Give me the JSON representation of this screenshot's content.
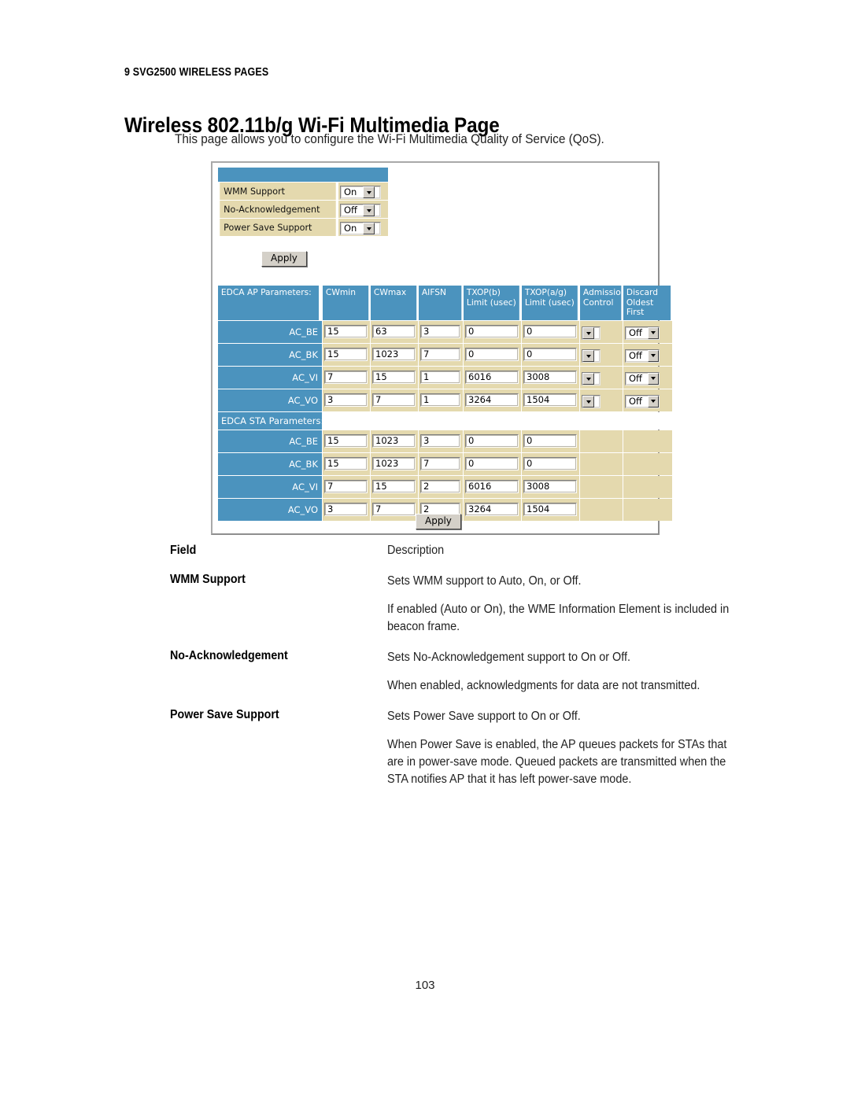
{
  "document": {
    "running_head": "9 SVG2500 WIRELESS PAGES",
    "title": "Wireless 802.11b/g Wi-Fi Multimedia Page",
    "intro": "This page allows you to configure the Wi-Fi Multimedia Quality of Service (QoS).",
    "page_number": "103"
  },
  "colors": {
    "header_blue": "#4b93be",
    "cell_beige": "#e4d9ae",
    "button_face": "#d4d0c8"
  },
  "screenshot": {
    "config": {
      "rows": [
        {
          "label": "WMM Support",
          "value": "On"
        },
        {
          "label": "No-Acknowledgement",
          "value": "Off"
        },
        {
          "label": "Power Save Support",
          "value": "On"
        }
      ],
      "apply_label": "Apply"
    },
    "edca": {
      "headers": {
        "ap_title": "EDCA AP Parameters:",
        "cwmin": "CWmin",
        "cwmax": "CWmax",
        "aifsn": "AIFSN",
        "txop_b_l1": "TXOP(b)",
        "txop_b_l2": "Limit (usec)",
        "txop_ag_l1": "TXOP(a/g)",
        "txop_ag_l2": "Limit (usec)",
        "admission_l1": "Admission",
        "admission_l2": "Control",
        "discard_l1": "Discard",
        "discard_l2": "Oldest First"
      },
      "sta_title": "EDCA STA Parameters:",
      "ap_rows": [
        {
          "ac": "AC_BE",
          "cwmin": "15",
          "cwmax": "63",
          "aifsn": "3",
          "txop_b": "0",
          "txop_ag": "0",
          "admission": "",
          "discard": "Off"
        },
        {
          "ac": "AC_BK",
          "cwmin": "15",
          "cwmax": "1023",
          "aifsn": "7",
          "txop_b": "0",
          "txop_ag": "0",
          "admission": "",
          "discard": "Off"
        },
        {
          "ac": "AC_VI",
          "cwmin": "7",
          "cwmax": "15",
          "aifsn": "1",
          "txop_b": "6016",
          "txop_ag": "3008",
          "admission": "",
          "discard": "Off"
        },
        {
          "ac": "AC_VO",
          "cwmin": "3",
          "cwmax": "7",
          "aifsn": "1",
          "txop_b": "3264",
          "txop_ag": "1504",
          "admission": "",
          "discard": "Off"
        }
      ],
      "sta_rows": [
        {
          "ac": "AC_BE",
          "cwmin": "15",
          "cwmax": "1023",
          "aifsn": "3",
          "txop_b": "0",
          "txop_ag": "0"
        },
        {
          "ac": "AC_BK",
          "cwmin": "15",
          "cwmax": "1023",
          "aifsn": "7",
          "txop_b": "0",
          "txop_ag": "0"
        },
        {
          "ac": "AC_VI",
          "cwmin": "7",
          "cwmax": "15",
          "aifsn": "2",
          "txop_b": "6016",
          "txop_ag": "3008"
        },
        {
          "ac": "AC_VO",
          "cwmin": "3",
          "cwmax": "7",
          "aifsn": "2",
          "txop_b": "3264",
          "txop_ag": "1504"
        }
      ],
      "apply_label": "Apply"
    }
  },
  "field_table": {
    "head": {
      "field": "Field",
      "description": "Description"
    },
    "rows": [
      {
        "field": "WMM Support",
        "paras": [
          "Sets WMM support to Auto, On, or Off.",
          "If enabled (Auto or On), the WME Information Element is included in beacon frame."
        ]
      },
      {
        "field": "No-Acknowledgement",
        "paras": [
          "Sets No-Acknowledgement support to On or Off.",
          "When enabled, acknowledgments for data are not transmitted."
        ]
      },
      {
        "field": "Power Save Support",
        "paras": [
          "Sets Power Save support to On or Off.",
          "When Power Save is enabled, the AP queues packets for STAs that are in power-save mode. Queued packets are transmitted when the STA notifies AP that it has left power-save mode."
        ]
      }
    ]
  }
}
